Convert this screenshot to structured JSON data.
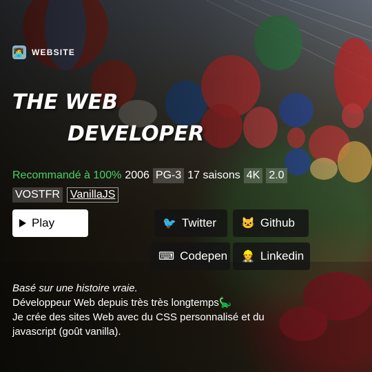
{
  "brand": {
    "avatar_icon": "developer-avatar-icon",
    "label": "WEBSITE"
  },
  "title": {
    "line1": "THE WEB",
    "line2": "DEVELOPER"
  },
  "meta": {
    "match": "Recommandé à 100%",
    "year": "2006",
    "rating": "PG-3",
    "seasons": "17 saisons",
    "quality": "4K",
    "version": "2.0"
  },
  "tags": {
    "lang": "VOSTFR",
    "tech": "VanillaJS"
  },
  "actions": {
    "play": "Play",
    "twitter": {
      "label": "Twitter",
      "icon": "bird-icon"
    },
    "github": {
      "label": "Github",
      "icon": "cat-icon"
    },
    "codepen": {
      "label": "Codepen",
      "icon": "keyboard-icon"
    },
    "linkedin": {
      "label": "Linkedin",
      "icon": "worker-icon"
    }
  },
  "description": {
    "tagline": "Basé sur une histoire vraie.",
    "line1": "Développeur Web depuis très très longtemps🦕",
    "line2": "Je crée des sites Web avec du CSS personnalisé et du javascript (goût vanilla)."
  },
  "colors": {
    "accent_green": "#46d369",
    "button_dark": "#141414",
    "play_bg": "#ffffff"
  }
}
